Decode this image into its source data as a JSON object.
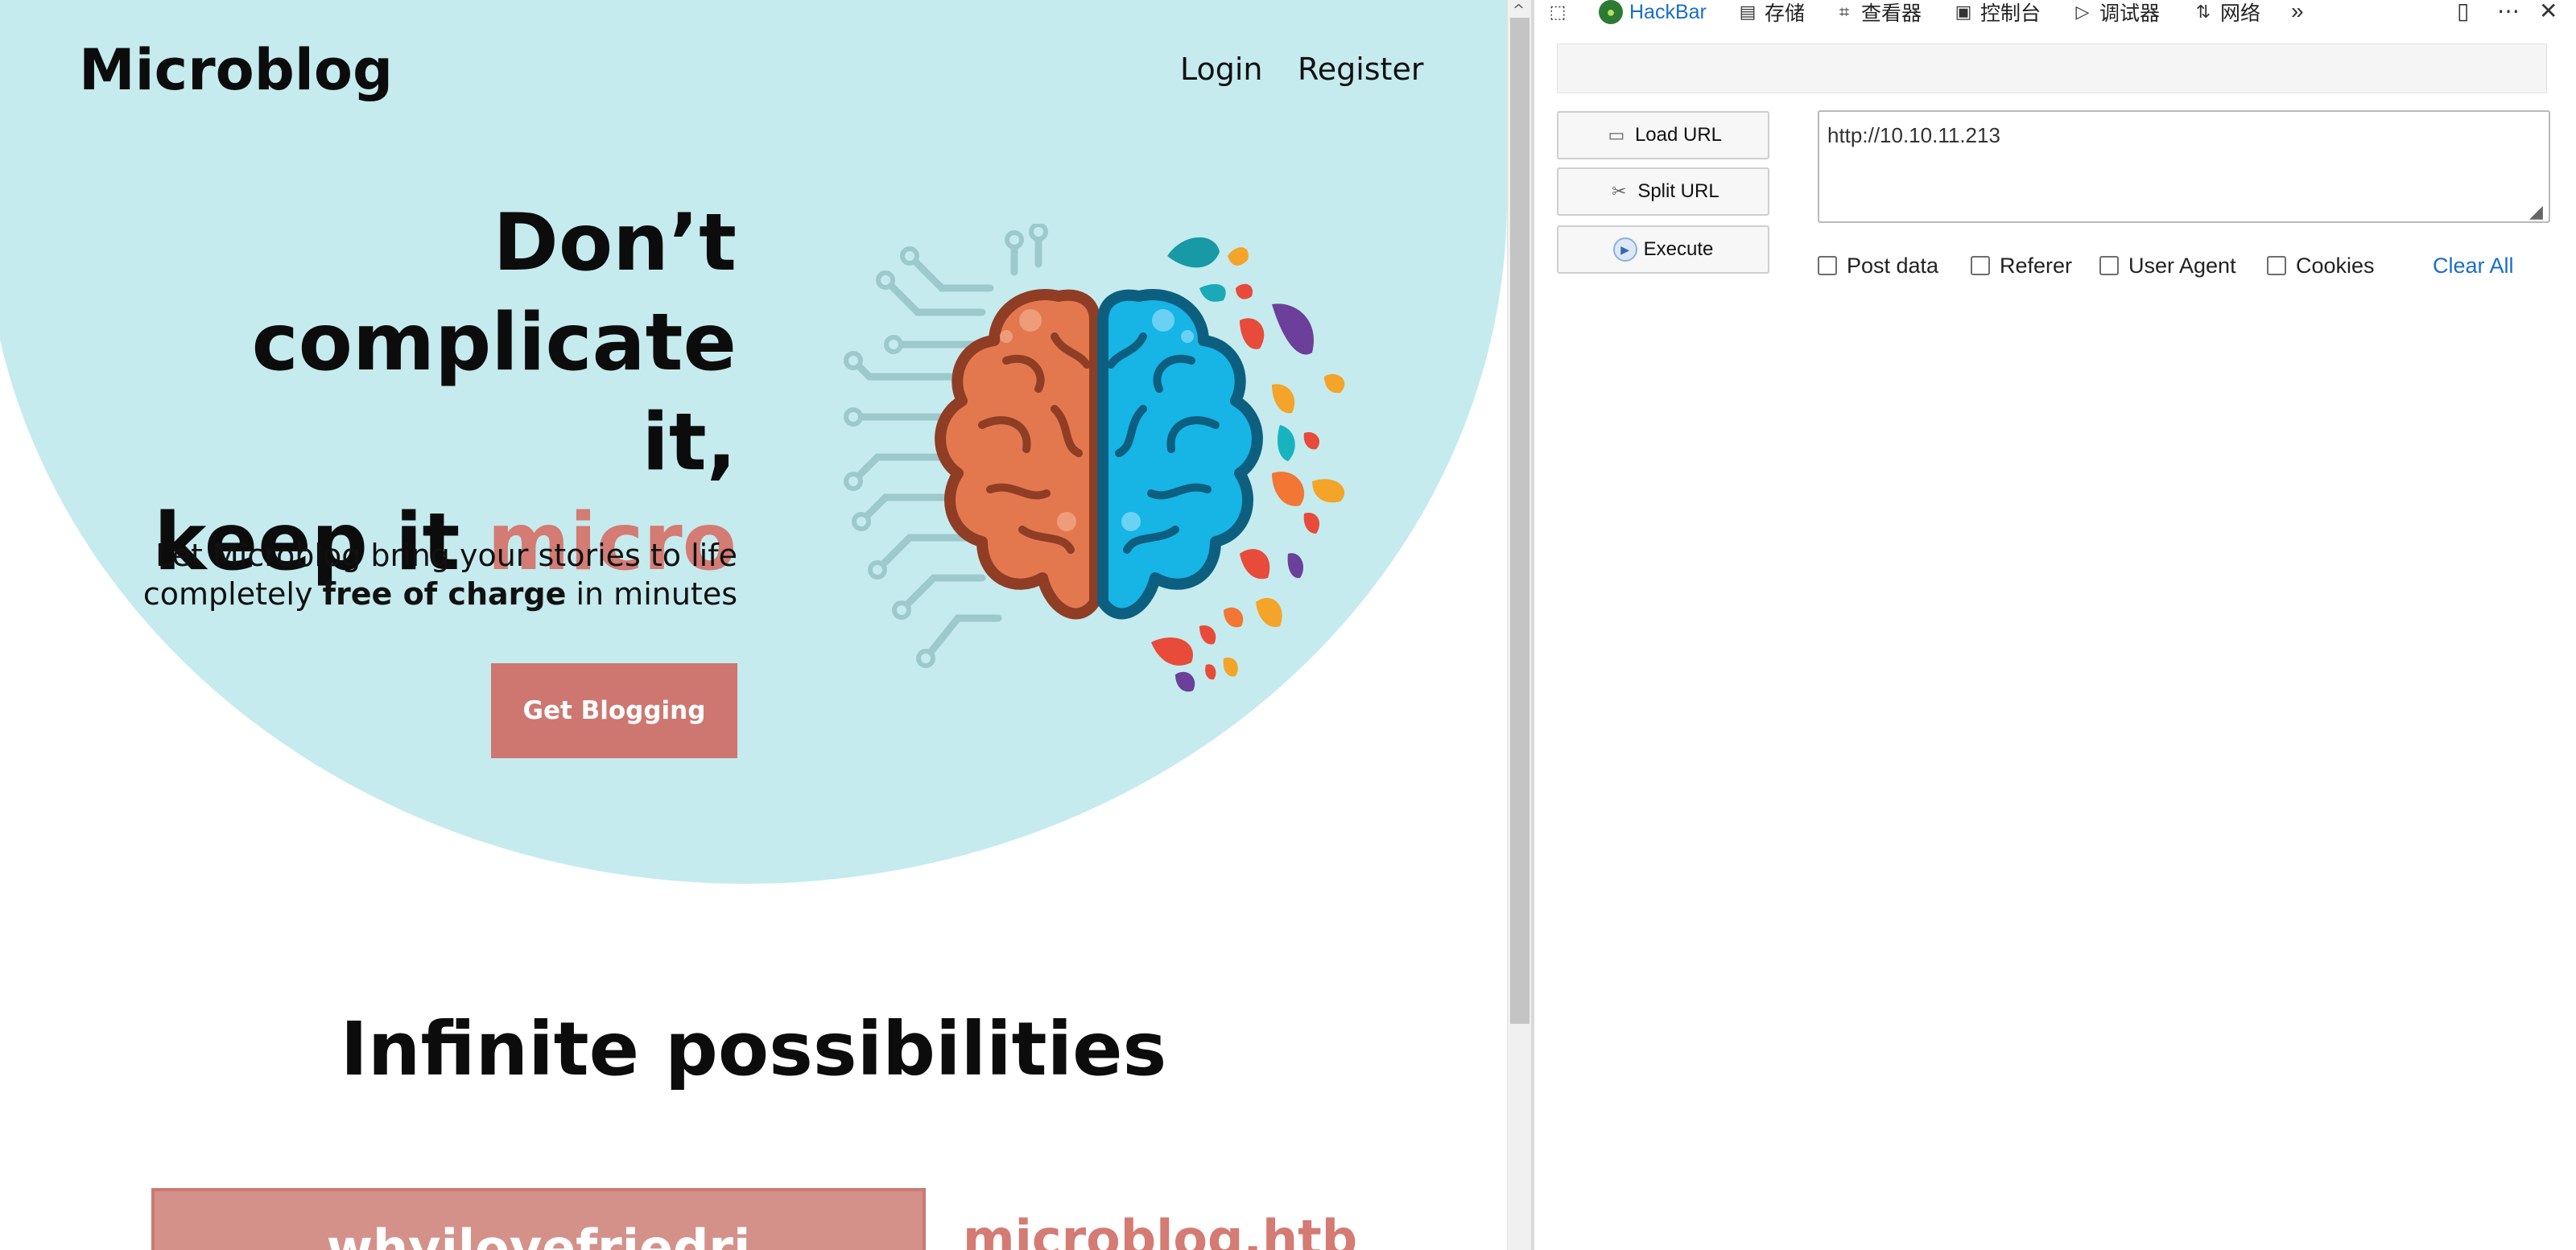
{
  "site": {
    "logo": "Microblog",
    "nav": {
      "login": "Login",
      "register": "Register"
    },
    "headline": {
      "line1": "Don’t complicate",
      "line2": "it,",
      "line3_plain": "keep it ",
      "line3_accent": "micro"
    },
    "subtitle": {
      "line1": "Let Microblog bring your stories to life",
      "line2_pre": "completely ",
      "line2_bold": "free of charge",
      "line2_post": " in minutes"
    },
    "cta": "Get Blogging",
    "section_title": "Infinite possibilities",
    "cards": [
      "whyilovefriedri",
      "microblog.htb"
    ],
    "colors": {
      "hero_bg": "#c5ebee",
      "accent": "#d47b73",
      "button": "#cd7770"
    }
  },
  "devtools": {
    "tabs": [
      {
        "icon": "pick-element-icon",
        "label": ""
      },
      {
        "icon": "hackbar-icon",
        "label": "HackBar"
      },
      {
        "icon": "storage-icon",
        "label": "存储"
      },
      {
        "icon": "inspector-icon",
        "label": "查看器"
      },
      {
        "icon": "console-icon",
        "label": "控制台"
      },
      {
        "icon": "debugger-icon",
        "label": "调试器"
      },
      {
        "icon": "network-icon",
        "label": "网络"
      }
    ],
    "hackbar": {
      "buttons": {
        "load": "Load URL",
        "split": "Split URL",
        "execute": "Execute"
      },
      "url_value": "http://10.10.11.213",
      "options": {
        "post": "Post data",
        "referer": "Referer",
        "user_agent": "User Agent",
        "cookies": "Cookies"
      },
      "clear_all": "Clear All"
    }
  }
}
